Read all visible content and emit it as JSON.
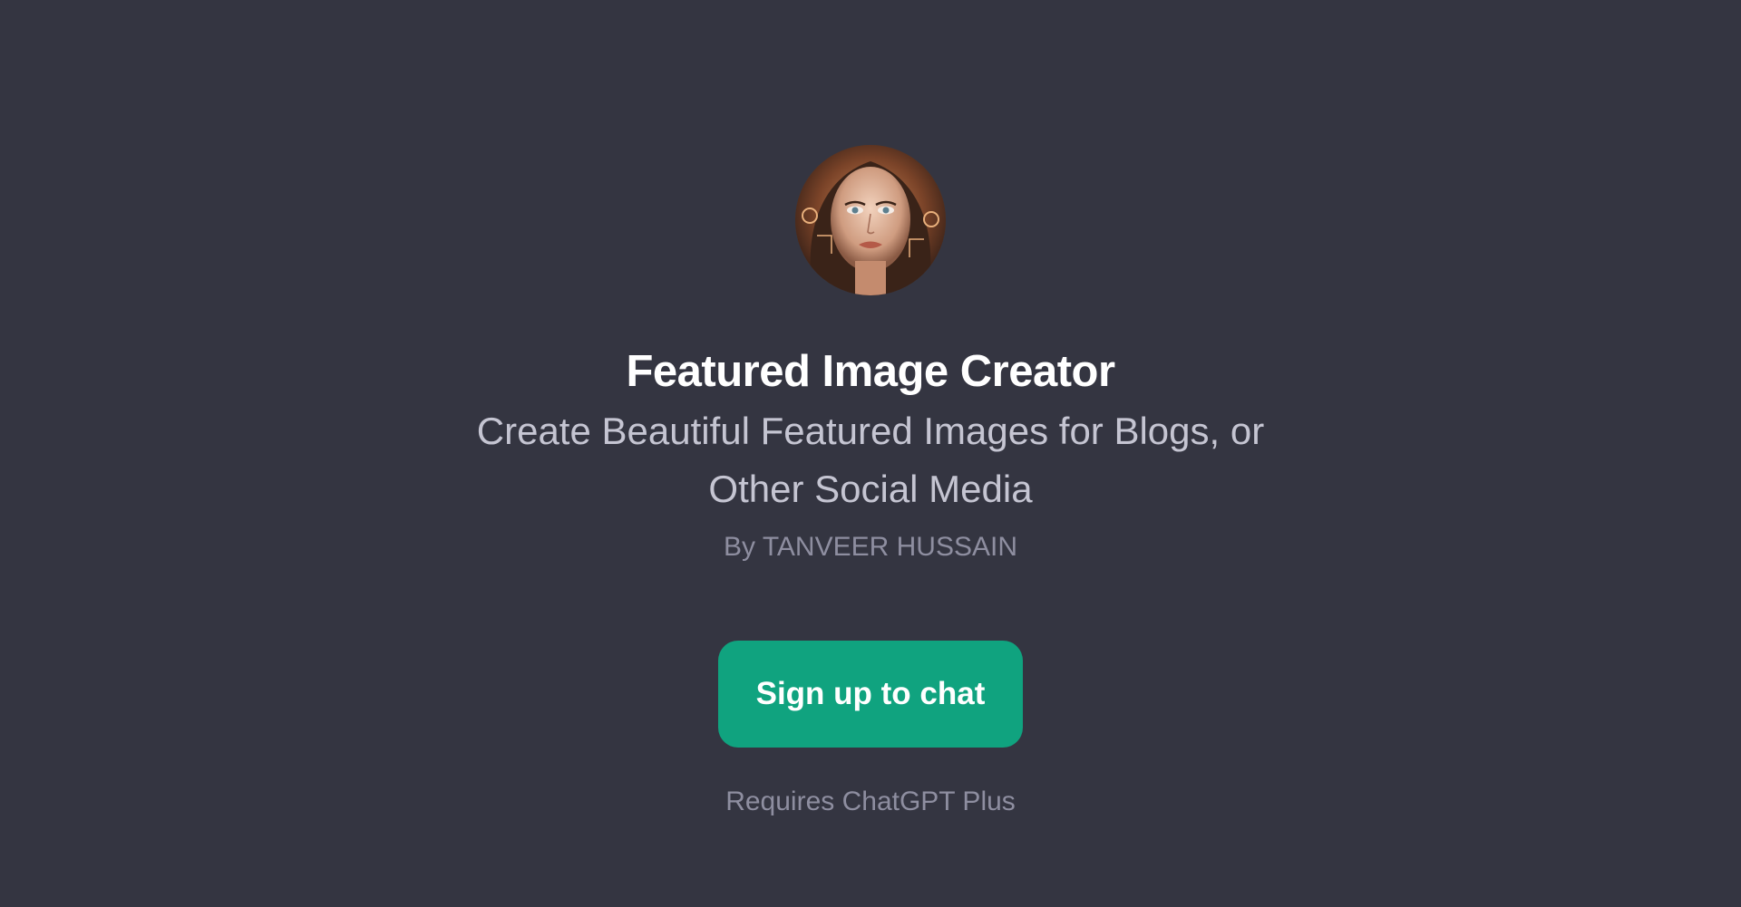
{
  "gpt": {
    "avatar_icon": "avatar-portrait",
    "title": "Featured Image Creator",
    "description": "Create Beautiful Featured Images for Blogs, or Other Social Media",
    "author": "By TANVEER HUSSAIN"
  },
  "actions": {
    "signup_label": "Sign up to chat"
  },
  "footer": {
    "requirement": "Requires ChatGPT Plus"
  },
  "colors": {
    "background": "#343541",
    "accent": "#10a37f",
    "title": "#ffffff",
    "subtitle": "#c5c5d2",
    "muted": "#8e8ea0"
  }
}
